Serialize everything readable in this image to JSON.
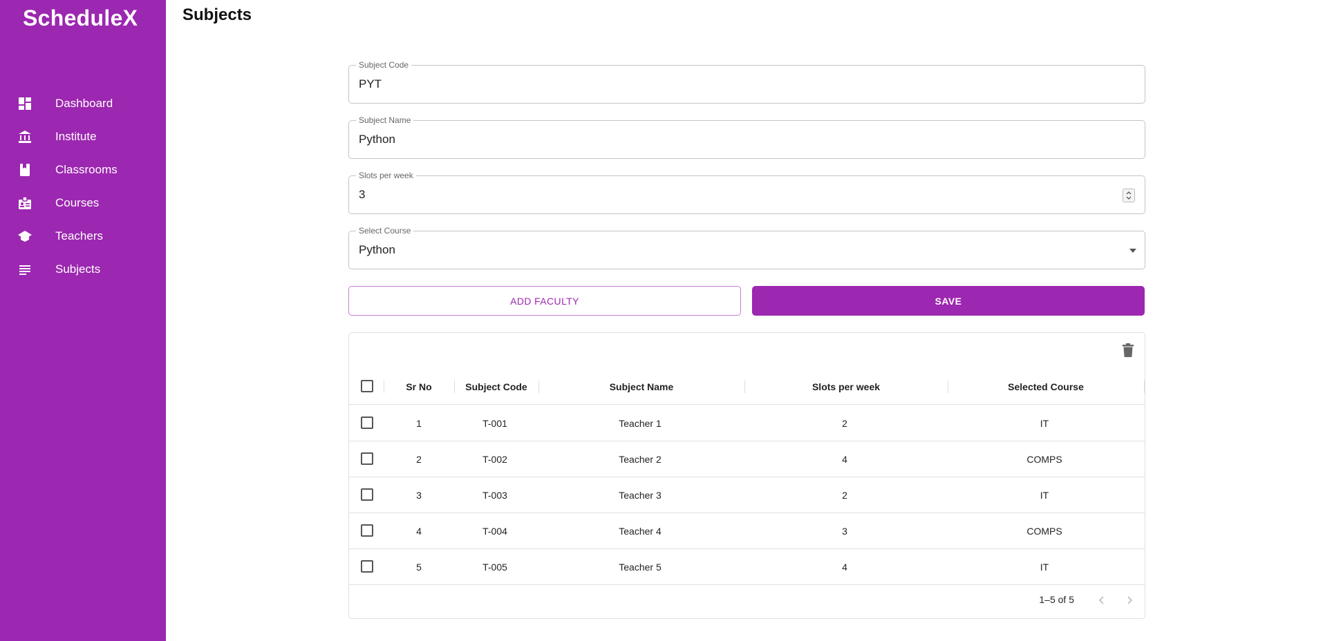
{
  "app": {
    "title": "ScheduleX"
  },
  "sidebar": {
    "items": [
      {
        "label": "Dashboard",
        "icon": "dashboard-icon"
      },
      {
        "label": "Institute",
        "icon": "institute-icon"
      },
      {
        "label": "Classrooms",
        "icon": "book-icon"
      },
      {
        "label": "Courses",
        "icon": "badge-icon"
      },
      {
        "label": "Teachers",
        "icon": "school-icon"
      },
      {
        "label": "Subjects",
        "icon": "list-icon"
      }
    ]
  },
  "page": {
    "title": "Subjects"
  },
  "form": {
    "subject_code": {
      "label": "Subject Code",
      "value": "PYT"
    },
    "subject_name": {
      "label": "Subject Name",
      "value": "Python"
    },
    "slots": {
      "label": "Slots per week",
      "value": "3"
    },
    "course": {
      "label": "Select Course",
      "value": "Python"
    }
  },
  "buttons": {
    "add_faculty": "ADD FACULTY",
    "save": "SAVE"
  },
  "table": {
    "columns": [
      "Sr No",
      "Subject Code",
      "Subject Name",
      "Slots per week",
      "Selected Course"
    ],
    "rows": [
      {
        "sr": "1",
        "code": "T-001",
        "name": "Teacher 1",
        "slots": "2",
        "course": "IT"
      },
      {
        "sr": "2",
        "code": "T-002",
        "name": "Teacher 2",
        "slots": "4",
        "course": "COMPS"
      },
      {
        "sr": "3",
        "code": "T-003",
        "name": "Teacher 3",
        "slots": "2",
        "course": "IT"
      },
      {
        "sr": "4",
        "code": "T-004",
        "name": "Teacher 4",
        "slots": "3",
        "course": "COMPS"
      },
      {
        "sr": "5",
        "code": "T-005",
        "name": "Teacher 5",
        "slots": "4",
        "course": "IT"
      }
    ],
    "pagination": "1–5 of 5"
  },
  "colors": {
    "primary": "#9c27b0",
    "border": "#c4c4c4"
  }
}
